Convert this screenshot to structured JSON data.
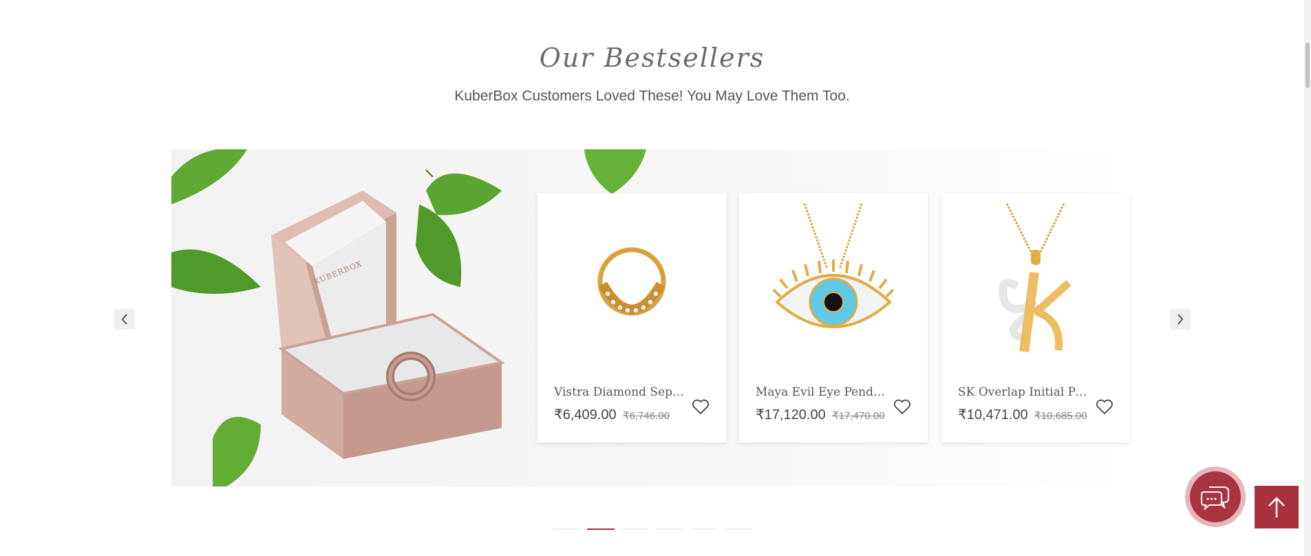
{
  "section": {
    "title": "Our Bestsellers",
    "subtitle": "KuberBox Customers Loved These! You May Love Them Too."
  },
  "banner": {
    "box_logo_text": "KUBERBOX"
  },
  "products": [
    {
      "name": "Vistra Diamond Septu...",
      "price": "₹6,409.00",
      "mrp": "₹6,746.00",
      "image": "gold-septum-ring"
    },
    {
      "name": "Maya Evil Eye Pendant",
      "price": "₹17,120.00",
      "mrp": "₹17,470.00",
      "image": "evil-eye-pendant"
    },
    {
      "name": "SK Overlap Initial Pen...",
      "price": "₹10,471.00",
      "mrp": "₹10,685.00",
      "image": "sk-initial-pendant"
    }
  ],
  "carousel": {
    "slide_count": 6,
    "active_index": 1
  },
  "icons": {
    "prev": "chevron-left-icon",
    "next": "chevron-right-icon",
    "wishlist": "heart-icon",
    "chat": "chat-bubbles-icon",
    "back_to_top": "arrow-up-icon"
  },
  "colors": {
    "accent": "#a8323c",
    "chat_ring": "#e7b6bb",
    "title": "#6b6b6b",
    "gold": "#e9b45a"
  }
}
